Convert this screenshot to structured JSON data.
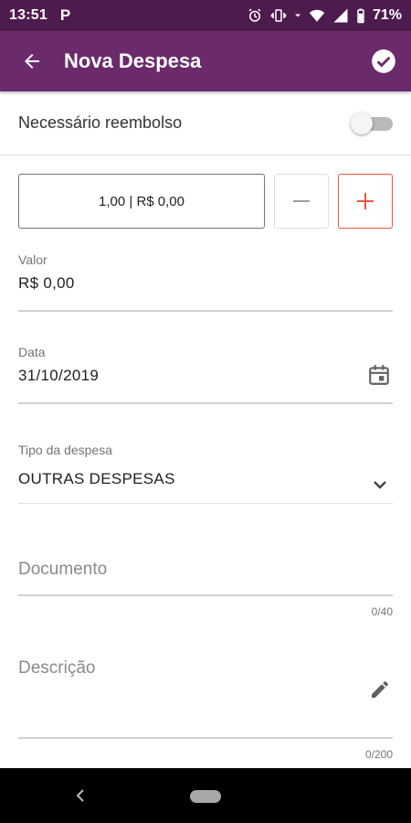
{
  "status_bar": {
    "time": "13:51",
    "notification_icon": "P",
    "battery": "71%",
    "icons": [
      "alarm-icon",
      "vibrate-icon",
      "wifi-icon",
      "signal-icon",
      "battery-icon"
    ]
  },
  "app_bar": {
    "title": "Nova Despesa",
    "back_icon": "arrow-back-icon",
    "confirm_icon": "check-circle-icon",
    "color": "#6b2a6b"
  },
  "reimbursement": {
    "label": "Necessário reembolso",
    "enabled": false
  },
  "quantity": {
    "display": "1,00 | R$ 0,00",
    "minus_symbol": "−",
    "plus_symbol": "+",
    "plus_color": "#e65a3a"
  },
  "valor": {
    "label": "Valor",
    "value": "R$ 0,00"
  },
  "data": {
    "label": "Data",
    "value": "31/10/2019",
    "icon": "calendar-icon"
  },
  "tipo": {
    "label": "Tipo da despesa",
    "value": "OUTRAS DESPESAS",
    "icon": "chevron-down-icon"
  },
  "documento": {
    "placeholder": "Documento",
    "counter": "0/40"
  },
  "descricao": {
    "placeholder": "Descrição",
    "counter": "0/200",
    "icon": "edit-icon"
  }
}
